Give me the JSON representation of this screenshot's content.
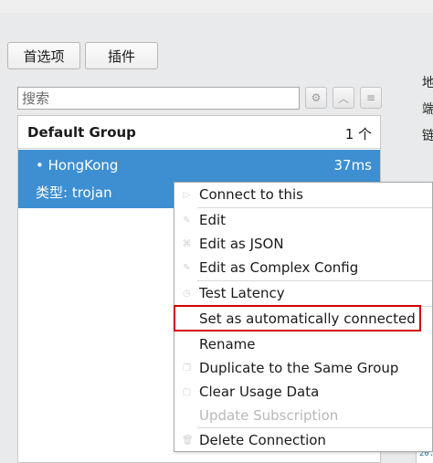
{
  "tabs": {
    "preferences": "首选项",
    "plugins": "插件"
  },
  "search": {
    "placeholder": "搜索"
  },
  "group": {
    "name": "Default Group",
    "count": "1 个"
  },
  "connection": {
    "name": "• HongKong",
    "latency": "37ms",
    "type_line": "类型: trojan"
  },
  "side_labels": [
    "地",
    "端",
    "链"
  ],
  "side_stub_text": "20.",
  "context_menu": {
    "items": [
      {
        "label": "Connect to this",
        "icon": "play-icon",
        "disabled": false
      },
      {
        "label": "Edit",
        "icon": "edit-icon",
        "disabled": false
      },
      {
        "label": "Edit as JSON",
        "icon": "json-icon",
        "disabled": false
      },
      {
        "label": "Edit as Complex Config",
        "icon": "edit-complex-icon",
        "disabled": false
      },
      {
        "label": "Test Latency",
        "icon": "latency-icon",
        "disabled": false
      },
      {
        "label": "Set as automatically connected",
        "icon": "",
        "disabled": false
      },
      {
        "label": "Rename",
        "icon": "",
        "disabled": false
      },
      {
        "label": "Duplicate to the Same Group",
        "icon": "duplicate-icon",
        "disabled": false
      },
      {
        "label": "Clear Usage Data",
        "icon": "clear-icon",
        "disabled": false
      },
      {
        "label": "Update Subscription",
        "icon": "",
        "disabled": true
      },
      {
        "label": "Delete Connection",
        "icon": "delete-icon",
        "disabled": false
      }
    ]
  },
  "colors": {
    "selection": "#3d8fd1",
    "highlight_box": "#d40000",
    "disabled_text": "#b8b8b8"
  }
}
